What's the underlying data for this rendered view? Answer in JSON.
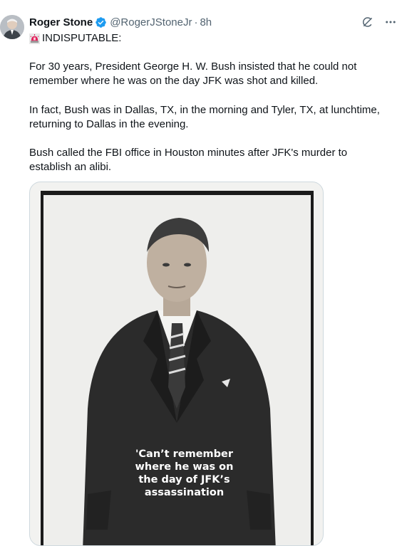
{
  "tweet": {
    "author_name": "Roger Stone",
    "handle": "@RogerJStoneJr",
    "separator": "·",
    "time": "8h",
    "headline": "INDISPUTABLE:",
    "paragraphs": [
      "For 30 years, President George H. W. Bush insisted that he could not remember where he was on the day JFK was shot and killed.",
      "In fact, Bush was in Dallas, TX, in the morning and Tyler, TX, at lunchtime, returning to Dallas in the evening.",
      "Bush called the FBI office in Houston minutes after JFK's murder to establish an alibi."
    ],
    "media": {
      "caption_lines": [
        "'Can’t remember",
        "where he was on",
        "the day of JFK’s",
        "assassination"
      ]
    }
  },
  "icons": {
    "verified": "verified-badge-icon",
    "siren": "rotating-light-emoji",
    "grok": "grok-icon",
    "more": "more-options-icon"
  },
  "colors": {
    "verified": "#1d9bf0",
    "muted_text": "#536471",
    "border": "#cfd9de"
  }
}
